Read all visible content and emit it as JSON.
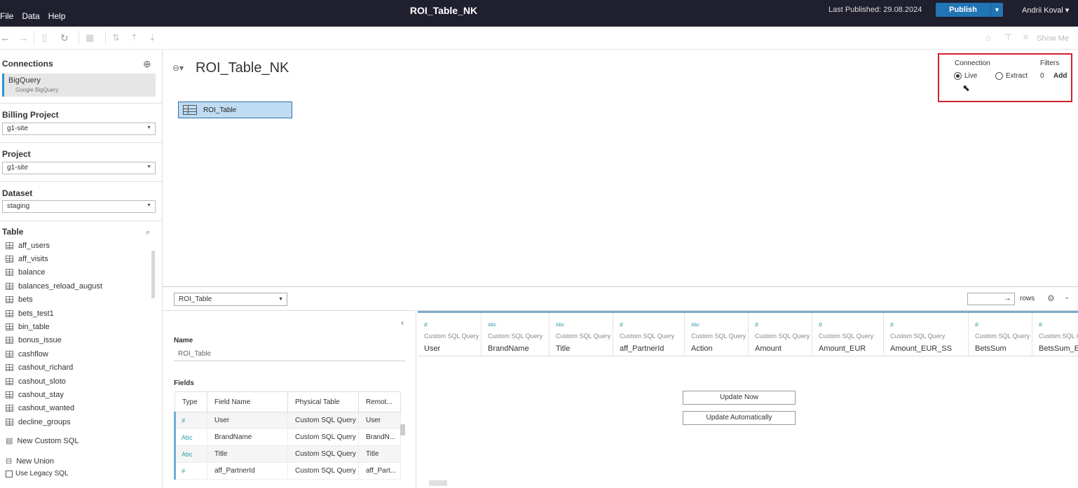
{
  "topbar": {
    "menu": [
      "File",
      "Data",
      "Help"
    ],
    "title": "ROI_Table_NK",
    "last_published": "Last Published: 29.08.2024",
    "publish": "Publish",
    "user": "Andrii Koval ▾"
  },
  "toolbar": {
    "show_me": "Show Me"
  },
  "sidebar": {
    "connections_title": "Connections",
    "connection": {
      "name": "BigQuery",
      "sub": "Google BigQuery"
    },
    "billing_project_label": "Billing Project",
    "billing_project_value": "g1-site",
    "project_label": "Project",
    "project_value": "g1-site",
    "dataset_label": "Dataset",
    "dataset_value": "staging",
    "table_label": "Table",
    "tables": [
      "aff_users",
      "aff_visits",
      "balance",
      "balances_reload_august",
      "bets",
      "bets_test1",
      "bin_table",
      "bonus_issue",
      "cashflow",
      "cashout_richard",
      "cashout_sloto",
      "cashout_stay",
      "cashout_wanted",
      "decline_groups"
    ],
    "new_custom_sql": "New Custom SQL",
    "new_union": "New Union",
    "use_legacy_sql": "Use Legacy SQL"
  },
  "canvas": {
    "title": "ROI_Table_NK",
    "table_name": "ROI_Table",
    "connection_label": "Connection",
    "live": "Live",
    "extract": "Extract",
    "filters_label": "Filters",
    "filters_count": "0",
    "add": "Add",
    "connection_mode": "Live"
  },
  "bottom": {
    "table_select": "ROI_Table",
    "rows_label": "rows",
    "name_label": "Name",
    "name_value": "ROI_Table",
    "fields_label": "Fields",
    "field_headers": [
      "Type",
      "Field Name",
      "Physical Table",
      "Remot..."
    ],
    "fields": [
      {
        "type": "#",
        "name": "User",
        "table": "Custom SQL Query",
        "remote": "User"
      },
      {
        "type": "Abc",
        "name": "BrandName",
        "table": "Custom SQL Query",
        "remote": "BrandN..."
      },
      {
        "type": "Abc",
        "name": "Title",
        "table": "Custom SQL Query",
        "remote": "Title"
      },
      {
        "type": "#",
        "name": "aff_PartnerId",
        "table": "Custom SQL Query",
        "remote": "aff_Part..."
      }
    ],
    "columns": [
      {
        "type": "#",
        "source": "Custom SQL Query",
        "name": "User"
      },
      {
        "type": "Abc",
        "source": "Custom SQL Query",
        "name": "BrandName"
      },
      {
        "type": "Abc",
        "source": "Custom SQL Query",
        "name": "Title"
      },
      {
        "type": "#",
        "source": "Custom SQL Query",
        "name": "aff_PartnerId"
      },
      {
        "type": "Abc",
        "source": "Custom SQL Query",
        "name": "Action"
      },
      {
        "type": "#",
        "source": "Custom SQL Query",
        "name": "Amount"
      },
      {
        "type": "#",
        "source": "Custom SQL Query",
        "name": "Amount_EUR"
      },
      {
        "type": "#",
        "source": "Custom SQL Query",
        "name": "Amount_EUR_SS"
      },
      {
        "type": "#",
        "source": "Custom SQL Query",
        "name": "BetsSum"
      },
      {
        "type": "#",
        "source": "Custom SQL Query",
        "name": "BetsSum_EU"
      }
    ],
    "update_now": "Update Now",
    "update_auto": "Update Automatically"
  },
  "colors": {
    "topbar": "#1f1f2e",
    "publish": "#2175b3",
    "highlight": "#d0212d",
    "selected_table": "#bfdcf3"
  }
}
